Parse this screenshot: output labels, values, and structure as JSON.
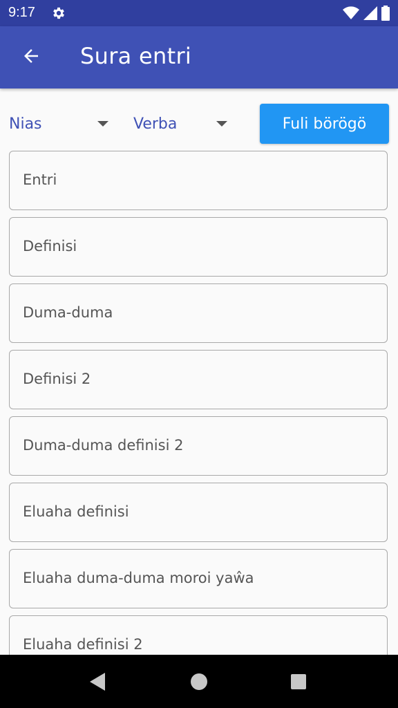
{
  "status_bar": {
    "time": "9:17",
    "icons": [
      "gear-icon",
      "wifi-icon",
      "signal-icon",
      "battery-icon"
    ]
  },
  "app_bar": {
    "title": "Sura entri",
    "back_icon": "arrow-left-icon"
  },
  "controls": {
    "language_value": "Nias",
    "part_of_speech_value": "Verba",
    "button_label": "Fuli börögö"
  },
  "fields": [
    {
      "placeholder": "Entri"
    },
    {
      "placeholder": "Definisi"
    },
    {
      "placeholder": "Duma-duma"
    },
    {
      "placeholder": "Definisi 2"
    },
    {
      "placeholder": "Duma-duma definisi 2"
    },
    {
      "placeholder": "Eluaha definisi"
    },
    {
      "placeholder": "Eluaha duma-duma moroi yaŵa"
    },
    {
      "placeholder": "Eluaha definisi 2"
    }
  ],
  "colors": {
    "status_bar": "#303f9f",
    "app_bar": "#3f51b5",
    "accent_button": "#2196f3",
    "dropdown_text": "#3f51b5"
  }
}
